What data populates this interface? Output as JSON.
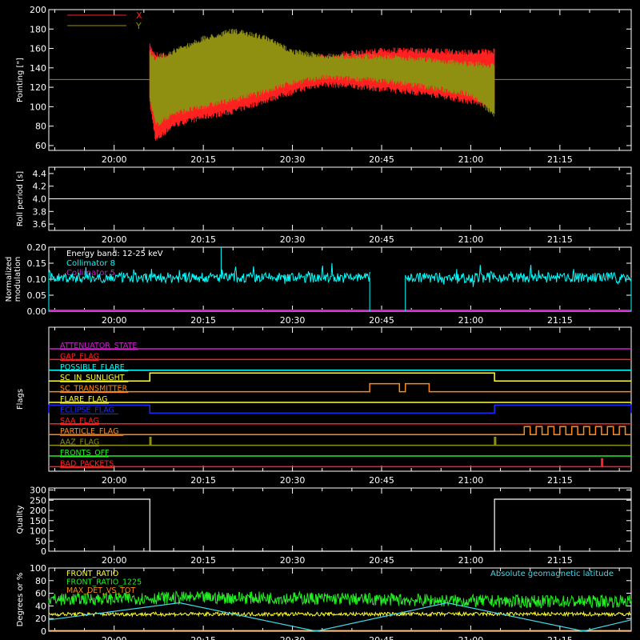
{
  "colors": {
    "background": "#000000",
    "axes": "#ffffff",
    "red": "#ff2020",
    "olive": "#8f8f12",
    "cyan": "#00ffff",
    "magenta": "#cc22cc",
    "white": "#ffffff",
    "green": "#22ee22",
    "yellow": "#ffff30",
    "orange": "#ff8a1a",
    "blue": "#1c2cff",
    "lightcyan": "#40d8e8"
  },
  "time_axis": {
    "range": [
      "19:49",
      "21:27"
    ],
    "ticks": [
      "20:00",
      "20:15",
      "20:30",
      "20:45",
      "21:00",
      "21:15"
    ]
  },
  "chart_data": [
    {
      "type": "line",
      "ylabel": "Pointing [\"]",
      "ylim": [
        55,
        200
      ],
      "yticks": [
        "60",
        "80",
        "100",
        "120",
        "140",
        "160",
        "180",
        "200"
      ],
      "legend": {
        "placement": "top-left"
      },
      "series": [
        {
          "name": "X",
          "color": "red",
          "x": [
            "20:06",
            "20:07",
            "20:10",
            "20:15",
            "20:20",
            "20:25",
            "20:30",
            "20:35",
            "20:40",
            "20:45",
            "20:50",
            "20:55",
            "21:00",
            "21:04"
          ],
          "upper": [
            165,
            157,
            155,
            150,
            150,
            150,
            152,
            155,
            158,
            161,
            161,
            160,
            159,
            160
          ],
          "lower": [
            100,
            62,
            78,
            86,
            92,
            102,
            112,
            120,
            118,
            115,
            112,
            108,
            102,
            97
          ]
        },
        {
          "name": "Y",
          "color": "olive",
          "x": [
            "20:06",
            "20:07",
            "20:10",
            "20:15",
            "20:20",
            "20:25",
            "20:30",
            "20:35",
            "20:40",
            "20:45",
            "20:50",
            "20:55",
            "21:00",
            "21:04"
          ],
          "upper": [
            160,
            152,
            160,
            173,
            181,
            175,
            160,
            155,
            155,
            154,
            153,
            150,
            147,
            145
          ],
          "lower": [
            105,
            78,
            90,
            97,
            104,
            112,
            122,
            127,
            126,
            124,
            120,
            115,
            110,
            88
          ]
        }
      ],
      "reference_level": 128
    },
    {
      "type": "line",
      "ylabel": "Roll period [s]",
      "ylim": [
        3.5,
        4.5
      ],
      "yticks": [
        "3.6",
        "3.8",
        "4.0",
        "4.2",
        "4.4"
      ],
      "series": [
        {
          "name": "",
          "color": "white",
          "x": [
            "19:49",
            "21:27"
          ],
          "y": [
            4.0,
            4.0
          ]
        }
      ]
    },
    {
      "type": "line",
      "ylabel": [
        "Normalized",
        "modulation"
      ],
      "ylim": [
        0,
        0.2
      ],
      "yticks": [
        "0.00",
        "0.05",
        "0.10",
        "0.15",
        "0.20"
      ],
      "legend": {
        "placement": "top-left",
        "title": "Energy band: 12-25 keV",
        "entries": [
          {
            "name": "Collimator 8",
            "color": "cyan"
          },
          {
            "name": "Collimator 5",
            "color": "magenta"
          }
        ]
      },
      "series": [
        {
          "name": "Collimator 8",
          "color": "cyan",
          "mean": 0.105,
          "segments": [
            [
              "19:49",
              "20:43"
            ],
            [
              "20:49",
              "21:27"
            ]
          ],
          "spikes": [
            {
              "x": "20:18",
              "y": 0.2
            }
          ]
        },
        {
          "name": "Collimator 5",
          "color": "magenta",
          "x": [
            "19:49",
            "21:27"
          ],
          "y": [
            0,
            0
          ]
        }
      ]
    },
    {
      "type": "line",
      "ylabel": "Flags",
      "flags": [
        {
          "name": "ATTENUATOR_STATE",
          "color": "magenta",
          "high": []
        },
        {
          "name": "GAP_FLAG",
          "color": "red",
          "high": []
        },
        {
          "name": "POSSIBLE_FLARE",
          "color": "cyan",
          "high": []
        },
        {
          "name": "SC_IN_SUNLIGHT",
          "color": "yellow",
          "high": [
            [
              "20:06",
              "21:04"
            ]
          ]
        },
        {
          "name": "SC_TRANSMITTER",
          "color": "orange",
          "high": [
            [
              "20:43",
              "20:48"
            ],
            [
              "20:49",
              "20:53"
            ]
          ]
        },
        {
          "name": "FLARE_FLAG",
          "color": "yellow",
          "high": []
        },
        {
          "name": "ECLIPSE_FLAG",
          "color": "blue",
          "high": [
            [
              "19:49",
              "20:06"
            ],
            [
              "21:04",
              "21:27"
            ]
          ]
        },
        {
          "name": "SAA_FLAG",
          "color": "red",
          "high": []
        },
        {
          "name": "PARTICLE_FLAG",
          "color": "orange",
          "high": [
            [
              "21:09",
              "21:10"
            ],
            [
              "21:11",
              "21:12"
            ],
            [
              "21:13",
              "21:14"
            ],
            [
              "21:15",
              "21:16"
            ],
            [
              "21:17",
              "21:18"
            ],
            [
              "21:19",
              "21:20"
            ],
            [
              "21:21",
              "21:22"
            ],
            [
              "21:23",
              "21:24"
            ],
            [
              "21:25",
              "21:26"
            ]
          ]
        },
        {
          "name": "AAZ_FLAG",
          "color": "olive",
          "high": [
            [
              "20:06",
              "20:06"
            ],
            [
              "21:04",
              "21:04"
            ]
          ]
        },
        {
          "name": "FRONTS_OFF",
          "color": "green",
          "high": []
        },
        {
          "name": "BAD_PACKETS",
          "color": "red",
          "high": [
            [
              "21:22",
              "21:22"
            ]
          ]
        }
      ]
    },
    {
      "type": "line",
      "ylabel": "Quality",
      "ylim": [
        0,
        310
      ],
      "yticks": [
        "0",
        "50",
        "100",
        "150",
        "200",
        "250",
        "300"
      ],
      "series": [
        {
          "name": "",
          "color": "white",
          "x": [
            "19:49",
            "20:06",
            "20:06",
            "20:06",
            "21:04",
            "21:04",
            "21:27"
          ],
          "y": [
            255,
            255,
            30,
            0,
            0,
            255,
            255
          ]
        }
      ]
    },
    {
      "type": "line",
      "ylabel": "Degrees or %",
      "ylim": [
        0,
        100
      ],
      "yticks": [
        "0",
        "20",
        "40",
        "60",
        "80",
        "100"
      ],
      "legend": {
        "placement": "top-left"
      },
      "series": [
        {
          "name": "FRONT_RATIO",
          "color": "yellow",
          "mean": 27
        },
        {
          "name": "FRONT_RATIO_1225",
          "color": "green",
          "mean": 50
        },
        {
          "name": "MAX_DET_VS_TOT",
          "color": "orange",
          "mean": 0
        },
        {
          "name": "Absolute geomagnetic latitude",
          "color": "lightcyan",
          "label_placement": "top-right",
          "x": [
            "19:49",
            "20:11",
            "20:34",
            "20:56",
            "21:19",
            "21:27"
          ],
          "y": [
            18,
            45,
            0,
            45,
            0,
            18
          ]
        }
      ]
    }
  ]
}
